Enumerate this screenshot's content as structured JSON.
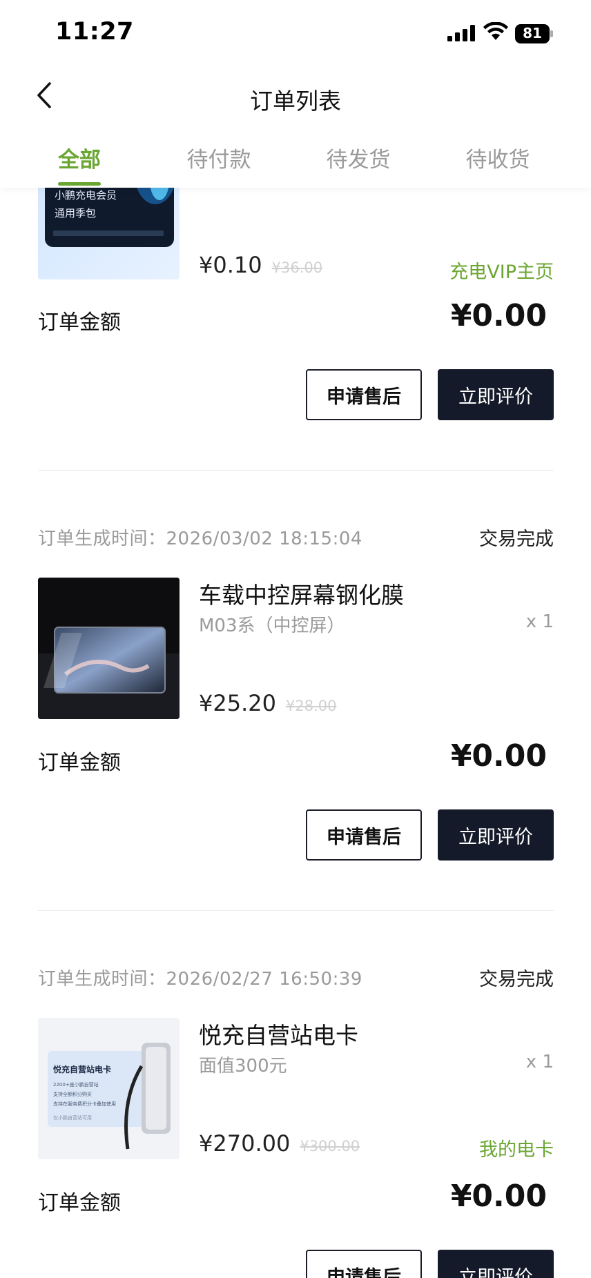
{
  "status_bar": {
    "time": "11:27",
    "battery": "81"
  },
  "nav": {
    "title": "订单列表"
  },
  "tabs": [
    {
      "label": "全部",
      "active": true
    },
    {
      "label": "待付款",
      "active": false
    },
    {
      "label": "待发货",
      "active": false
    },
    {
      "label": "待收货",
      "active": false
    }
  ],
  "orders": [
    {
      "thumb_text_1": "小鹏充电会员",
      "thumb_text_2": "通用季包",
      "price": "¥0.10",
      "original_price": "¥36.00",
      "link": "充电VIP主页",
      "total_label": "订单金额",
      "total": "¥0.00",
      "btn_after_sale": "申请售后",
      "btn_review": "立即评价"
    },
    {
      "time_label": "订单生成时间：",
      "time": "2026/03/02 18:15:04",
      "status": "交易完成",
      "title": "车载中控屏幕钢化膜",
      "spec": "M03系（中控屏）",
      "qty": "x 1",
      "price": "¥25.20",
      "original_price": "¥28.00",
      "total_label": "订单金额",
      "total": "¥0.00",
      "btn_after_sale": "申请售后",
      "btn_review": "立即评价"
    },
    {
      "time_label": "订单生成时间：",
      "time": "2026/02/27 16:50:39",
      "status": "交易完成",
      "title": "悦充自营站电卡",
      "spec": "面值300元",
      "qty": "x 1",
      "thumb_text_1": "悦充自营站电卡",
      "thumb_bullets": [
        "2200+座小鹏自营站",
        "支持全额积分购买",
        "支持在服务费积分卡叠加使用"
      ],
      "thumb_footer": "仅小鹏自营站可用",
      "price": "¥270.00",
      "original_price": "¥300.00",
      "link": "我的电卡",
      "total_label": "订单金额",
      "total": "¥0.00",
      "btn_after_sale": "申请售后",
      "btn_review": "立即评价"
    }
  ],
  "colors": {
    "accent": "#6aa632",
    "dark_button": "#141a29",
    "muted": "#9a9a9a"
  }
}
